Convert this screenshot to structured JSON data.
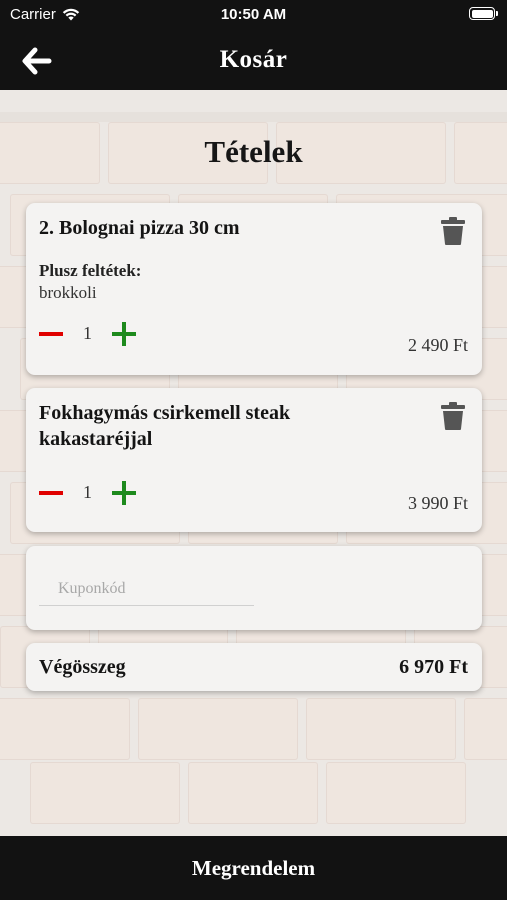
{
  "status_bar": {
    "carrier": "Carrier",
    "time": "10:50 AM"
  },
  "navbar": {
    "title": "Kosár"
  },
  "section": {
    "title": "Tételek"
  },
  "items": [
    {
      "name": "2. Bolognai pizza 30 cm",
      "extras_label": "Plusz feltétek:",
      "extras": "brokkoli",
      "quantity": "1",
      "price": "2 490 Ft"
    },
    {
      "name": "Fokhagymás csirkemell steak kakastaréjjal",
      "quantity": "1",
      "price": "3 990 Ft"
    }
  ],
  "coupon": {
    "placeholder": "Kuponkód",
    "value": ""
  },
  "total": {
    "label": "Végösszeg",
    "value": "6 970 Ft"
  },
  "order_button": {
    "label": "Megrendelem"
  },
  "colors": {
    "bar": "#121212",
    "minus": "#e00000",
    "plus": "#1d8a1d",
    "card": "#f4f3f2"
  },
  "icons": [
    "wifi-icon",
    "battery-icon",
    "back-arrow-icon",
    "trash-icon",
    "minus-icon",
    "plus-icon"
  ]
}
